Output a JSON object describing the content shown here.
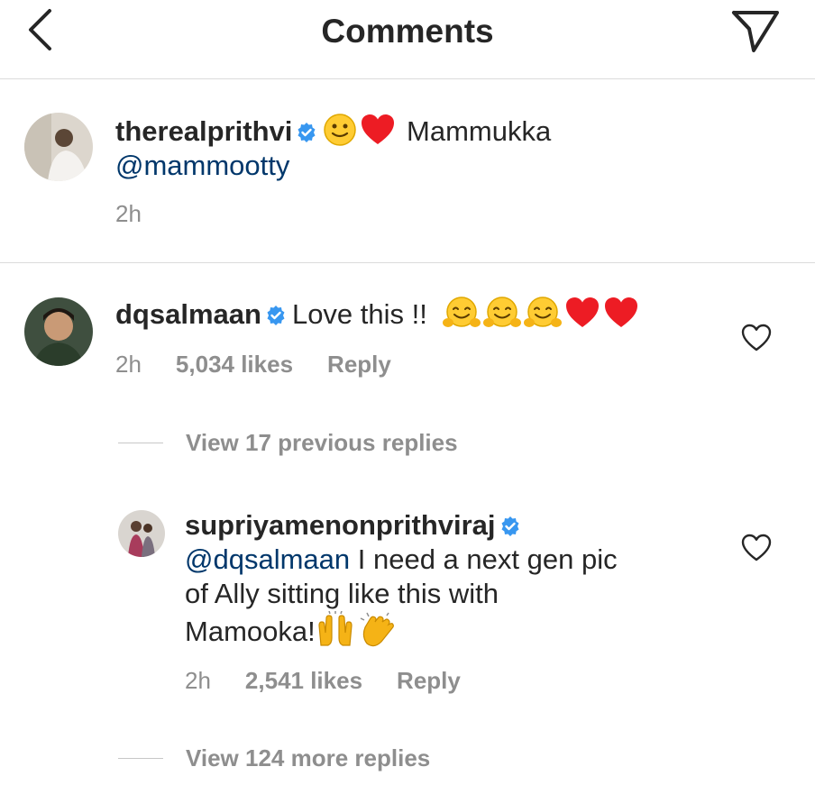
{
  "header": {
    "title": "Comments",
    "back_icon": "chevron-left-icon",
    "share_icon": "send-icon"
  },
  "caption": {
    "username": "therealprithvi",
    "text_after_emoji": "Mammukka",
    "mention": "@mammootty",
    "time": "2h"
  },
  "comment": {
    "username": "dqsalmaan",
    "text": "Love this !!",
    "time": "2h",
    "likes": "5,034 likes",
    "reply_label": "Reply",
    "view_previous": "View 17 previous replies"
  },
  "reply": {
    "username": "supriyamenonprithviraj",
    "mention": "@dqsalmaan",
    "text_line1": "I need a next gen pic",
    "text_line2": "of Ally sitting like this with",
    "text_line3": "Mamooka!",
    "time": "2h",
    "likes": "2,541 likes",
    "reply_label": "Reply",
    "view_more": "View 124 more replies"
  },
  "colors": {
    "text": "#262626",
    "secondary": "#8e8e8e",
    "mention": "#00376b",
    "verified": "#3897f0",
    "heart": "#ed1c24",
    "divider": "#dbdbdb"
  }
}
